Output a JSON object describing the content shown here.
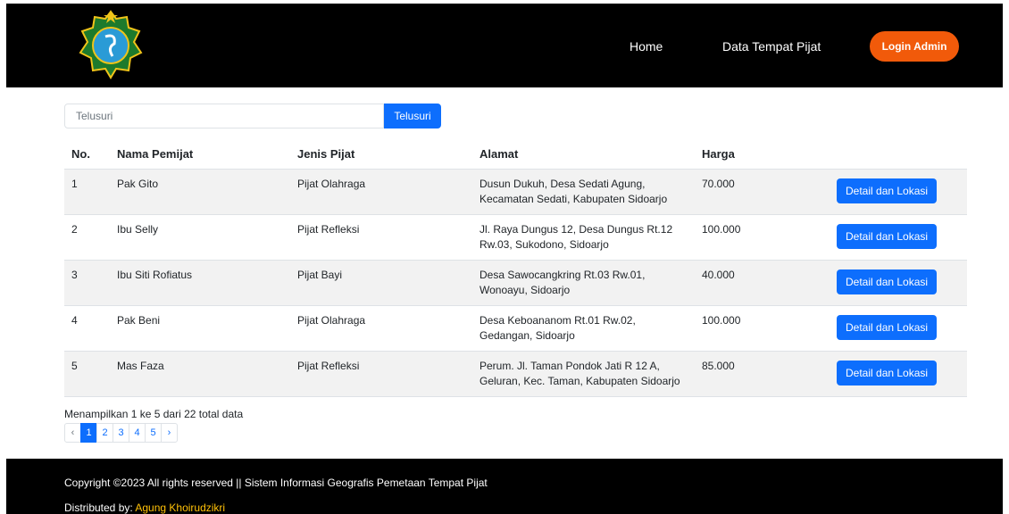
{
  "nav": {
    "home": "Home",
    "data": "Data Tempat Pijat",
    "login": "Login Admin"
  },
  "search": {
    "placeholder": "Telusuri",
    "button": "Telusuri"
  },
  "table": {
    "headers": [
      "No.",
      "Nama Pemijat",
      "Jenis Pijat",
      "Alamat",
      "Harga",
      ""
    ],
    "rows": [
      {
        "no": "1",
        "nama": "Pak Gito",
        "jenis": "Pijat Olahraga",
        "alamat": "Dusun Dukuh, Desa Sedati Agung, Kecamatan Sedati, Kabupaten Sidoarjo",
        "harga": "70.000",
        "action": "Detail dan Lokasi"
      },
      {
        "no": "2",
        "nama": "Ibu Selly",
        "jenis": "Pijat Refleksi",
        "alamat": "Jl. Raya Dungus 12, Desa Dungus Rt.12 Rw.03, Sukodono, Sidoarjo",
        "harga": "100.000",
        "action": "Detail dan Lokasi"
      },
      {
        "no": "3",
        "nama": "Ibu Siti Rofiatus",
        "jenis": "Pijat Bayi",
        "alamat": "Desa Sawocangkring Rt.03 Rw.01, Wonoayu, Sidoarjo",
        "harga": "40.000",
        "action": "Detail dan Lokasi"
      },
      {
        "no": "4",
        "nama": "Pak Beni",
        "jenis": "Pijat Olahraga",
        "alamat": "Desa Keboananom Rt.01 Rw.02, Gedangan, Sidoarjo",
        "harga": "100.000",
        "action": "Detail dan Lokasi"
      },
      {
        "no": "5",
        "nama": "Mas Faza",
        "jenis": "Pijat Refleksi",
        "alamat": "Perum. Jl. Taman Pondok Jati R 12 A, Geluran, Kec. Taman, Kabupaten Sidoarjo",
        "harga": "85.000",
        "action": "Detail dan Lokasi"
      }
    ]
  },
  "info": "Menampilkan 1 ke 5 dari 22 total data",
  "pagination": {
    "prev": "‹",
    "pages": [
      "1",
      "2",
      "3",
      "4",
      "5"
    ],
    "next": "›",
    "active": "1"
  },
  "footer": {
    "copyright": "Copyright ©2023 All rights reserved || Sistem Informasi Geografis Pemetaan Tempat Pijat",
    "distributed_label": "Distributed by: ",
    "distributed_name": "Agung Khoirudzikri"
  },
  "colors": {
    "accent": "#0d6efd",
    "login": "#f15a0a",
    "footer_link": "#ffc107"
  },
  "icons": {
    "logo": "regency-emblem-logo"
  }
}
